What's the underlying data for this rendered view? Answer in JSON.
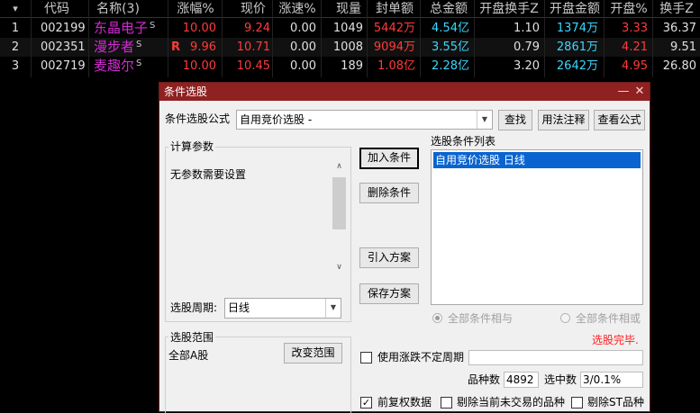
{
  "grid": {
    "headers": [
      "▾",
      "代码",
      "名称(3)",
      "涨幅%",
      "现价",
      "涨速%",
      "现量",
      "封单额",
      "总金额",
      "开盘换手Z",
      "开盘金额",
      "开盘%",
      "换手Z"
    ],
    "rows": [
      {
        "num": "1",
        "code": "002199",
        "name": "东晶电子",
        "sup": "S",
        "rmark": "",
        "change": "10.00",
        "price": "9.24",
        "speed": "0.00",
        "vol": "1049",
        "seal": "5442万",
        "total": "4.54亿",
        "open_turn": "1.10",
        "open_amt": "1374万",
        "open_pct": "3.33",
        "turn": "36.37"
      },
      {
        "num": "2",
        "code": "002351",
        "name": "漫步者",
        "sup": "S",
        "rmark": "R",
        "change": "9.96",
        "price": "10.71",
        "speed": "0.00",
        "vol": "1008",
        "seal": "9094万",
        "total": "3.55亿",
        "open_turn": "0.79",
        "open_amt": "2861万",
        "open_pct": "4.21",
        "turn": "9.51"
      },
      {
        "num": "3",
        "code": "002719",
        "name": "麦趣尔",
        "sup": "S",
        "rmark": "",
        "change": "10.00",
        "price": "10.45",
        "speed": "0.00",
        "vol": "189",
        "seal": "1.08亿",
        "total": "2.28亿",
        "open_turn": "3.20",
        "open_amt": "2642万",
        "open_pct": "4.95",
        "turn": "26.80"
      }
    ]
  },
  "dialog": {
    "title": "条件选股",
    "min_btn": "—",
    "close_btn": "✕",
    "formula_label": "条件选股公式",
    "formula_value": "自用竞价选股 -",
    "find_btn": "查找",
    "usage_btn": "用法注释",
    "view_btn": "查看公式",
    "params_group": "计算参数",
    "params_text": "无参数需要设置",
    "period_label": "选股周期:",
    "period_value": "日线",
    "add_btn": "加入条件",
    "delete_btn": "删除条件",
    "import_btn": "引入方案",
    "save_btn": "保存方案",
    "list_label": "选股条件列表",
    "list_items": [
      "自用竞价选股  日线"
    ],
    "radio_and": "全部条件相与",
    "radio_or": "全部条件相或",
    "status": "选股完毕.",
    "range_group": "选股范围",
    "range_text": "全部A股",
    "change_range_btn": "改变范围",
    "use_period_label": "使用涨跌不定周期",
    "count_label": "品种数",
    "count_value": "4892",
    "selected_label": "选中数",
    "selected_value": "3/0.1%",
    "chk_adjusted": "前复权数据",
    "chk_exclude_untraded": "剔除当前未交易的品种",
    "chk_exclude_st": "剔除ST品种"
  }
}
